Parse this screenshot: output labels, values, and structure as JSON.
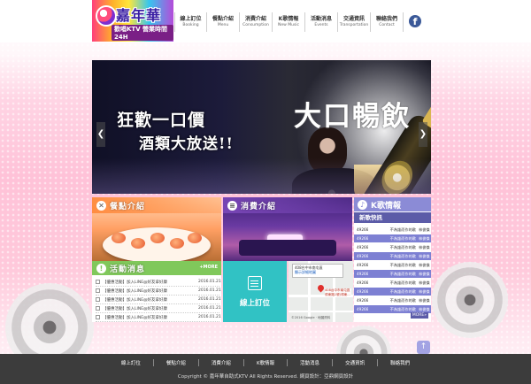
{
  "logo": {
    "title": "嘉年華",
    "subtitle": "歡唱KTV 營業時間24H"
  },
  "nav": [
    {
      "zh": "線上訂位",
      "en": "Booking"
    },
    {
      "zh": "餐點介紹",
      "en": "Menu"
    },
    {
      "zh": "消費介紹",
      "en": "Consumption"
    },
    {
      "zh": "K歌情報",
      "en": "New Music"
    },
    {
      "zh": "活動消息",
      "en": "Events"
    },
    {
      "zh": "交通資訊",
      "en": "Transportation"
    },
    {
      "zh": "聯絡我們",
      "en": "Contact"
    }
  ],
  "social": {
    "facebook": "f"
  },
  "banner": {
    "line1": "狂歡一口價",
    "line2": "酒類大放送!!",
    "line3": "大口暢飲",
    "prev": "❮",
    "next": "❯"
  },
  "menu_panel": {
    "title": "餐點介紹",
    "icon": "utensils-icon"
  },
  "consume_panel": {
    "title": "消費介紹",
    "icon": "note-icon"
  },
  "events": {
    "title": "活動消息",
    "more": "+MORE",
    "items": [
      {
        "title": "【優惠活動】加入LINE@好友拿好康",
        "date": "2016.01.21"
      },
      {
        "title": "【優惠活動】加入LINE@好友拿好康",
        "date": "2016.01.21"
      },
      {
        "title": "【優惠活動】加入LINE@好友拿好康",
        "date": "2016.01.21"
      },
      {
        "title": "【優惠活動】加入LINE@好友拿好康",
        "date": "2016.01.21"
      },
      {
        "title": "【優惠活動】加入LINE@好友拿好康",
        "date": "2016.01.21"
      }
    ]
  },
  "booking": {
    "label": "線上訂位"
  },
  "map": {
    "info": "408台中市南屯區",
    "link": "顯示詳細地圖",
    "label": "408台中市南屯區嶺東路1號(嶺東...",
    "footer": "©2016 Google · 地圖資料"
  },
  "ktv": {
    "title": "K歌情報",
    "subtitle": "新歌快訊",
    "more": "MORE»",
    "rows": [
      {
        "code": "49266",
        "song": "不為誰而作的歌",
        "artist": "林俊傑"
      },
      {
        "code": "49266",
        "song": "不為誰而作的歌",
        "artist": "林俊傑"
      },
      {
        "code": "49266",
        "song": "不為誰而作的歌",
        "artist": "林俊傑"
      },
      {
        "code": "49266",
        "song": "不為誰而作的歌",
        "artist": "林俊傑"
      },
      {
        "code": "49266",
        "song": "不為誰而作的歌",
        "artist": "林俊傑"
      },
      {
        "code": "49266",
        "song": "不為誰而作的歌",
        "artist": "林俊傑"
      },
      {
        "code": "49266",
        "song": "不為誰而作的歌",
        "artist": "林俊傑"
      },
      {
        "code": "49266",
        "song": "不為誰而作的歌",
        "artist": "林俊傑"
      },
      {
        "code": "49266",
        "song": "不為誰而作的歌",
        "artist": "林俊傑"
      },
      {
        "code": "49266",
        "song": "不為誰而作的歌",
        "artist": "林俊傑"
      }
    ]
  },
  "totop": "↑",
  "footer": {
    "links": [
      "線上訂位",
      "餐點介紹",
      "消費介紹",
      "K歌情報",
      "活動消息",
      "交通資訊",
      "聯絡我們"
    ],
    "copyright": "Copyright © 嘉年華自助式KTV All Rights Reserved. 網頁設計：亞鼎網頁設計"
  },
  "colors": {
    "menu_head": "#ff8a3d",
    "consume_head": "#7a47b8",
    "events_head": "#80c85b",
    "booking": "#31c2c4",
    "ktv_head": "#8b8bd6",
    "ktv_row": "#7d80d3",
    "footer": "#3c3c3c"
  }
}
